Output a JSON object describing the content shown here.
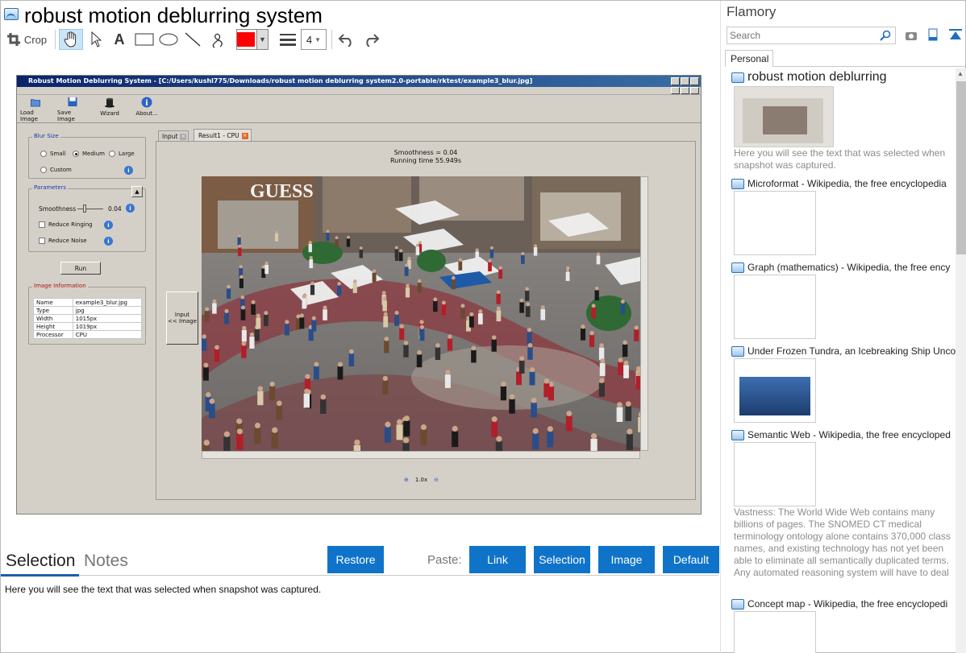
{
  "app": {
    "title": "robust motion deblurring system",
    "toolbar": {
      "crop_label": "Crop",
      "line_width": "4",
      "color": "#ff0000",
      "tools": [
        "crop-icon",
        "hand-icon",
        "pointer-icon",
        "text-icon",
        "rectangle-icon",
        "ellipse-icon",
        "line-icon",
        "freehand-icon",
        "color-swatch",
        "line-width-icon",
        "undo-icon",
        "redo-icon"
      ]
    }
  },
  "screenshot": {
    "window_title": "Robust Motion Deblurring System - [C:/Users/kushl775/Downloads/robust motion deblurring system2.0-portable/rktest/example3_blur.jpg]",
    "toolbar": [
      {
        "label": "Load Image",
        "icon": "folder-icon"
      },
      {
        "label": "Save Image",
        "icon": "save-icon"
      },
      {
        "label": "Wizard",
        "icon": "wizard-hat-icon"
      },
      {
        "label": "About...",
        "icon": "info-icon"
      }
    ],
    "blur_size": {
      "title": "Blur Size",
      "options": [
        "Small",
        "Medium",
        "Large",
        "Custom"
      ],
      "selected": "Medium"
    },
    "parameters": {
      "title": "Parameters",
      "smoothness_label": "Smoothness",
      "smoothness_value": "0.04",
      "reduce_ringing": "Reduce Ringing",
      "reduce_noise": "Reduce Noise"
    },
    "run_label": "Run",
    "image_info": {
      "title": "Image Information",
      "rows": [
        [
          "Name",
          "example3_blur.jpg"
        ],
        [
          "Type",
          "jpg"
        ],
        [
          "Width",
          "1015px"
        ],
        [
          "Height",
          "1019px"
        ],
        [
          "Processor",
          "CPU"
        ]
      ]
    },
    "tabs": [
      "Input",
      "Result1 - CPU"
    ],
    "smoothness_text": "Smoothness = 0.04",
    "running_time": "Running time 55.949s",
    "input_button": [
      "Input",
      "<< Image"
    ],
    "zoom": "1.0x",
    "photo_sign": "GUESS"
  },
  "bottom": {
    "tabs": [
      "Selection",
      "Notes"
    ],
    "restore_label": "Restore",
    "paste_label": "Paste:",
    "paste_buttons": [
      "Link",
      "Selection",
      "Image",
      "Default"
    ],
    "note_text": "Here you will see the text that was selected when snapshot was captured."
  },
  "sidebar": {
    "title": "Flamory",
    "search_placeholder": "Search",
    "tab": "Personal",
    "items": [
      {
        "title": "robust motion deblurring",
        "desc": "Here you will see the text that was selected when snapshot was captured."
      },
      {
        "title": "Microformat - Wikipedia, the free encyclopedia",
        "desc": ""
      },
      {
        "title": "Graph (mathematics) - Wikipedia, the free ency",
        "desc": ""
      },
      {
        "title": "Under Frozen Tundra, an Icebreaking Ship Unco",
        "desc": ""
      },
      {
        "title": "Semantic Web - Wikipedia, the free encycloped",
        "desc": "Vastness: The World Wide Web contains many billions of pages. The SNOMED CT medical terminology ontology alone contains 370,000 class names, and existing technology has not yet been able to eliminate all semantically duplicated terms. Any automated reasoning system will have to deal with truly huge inputs."
      },
      {
        "title": "Concept map - Wikipedia, the free encyclopedi",
        "desc": ""
      }
    ]
  }
}
